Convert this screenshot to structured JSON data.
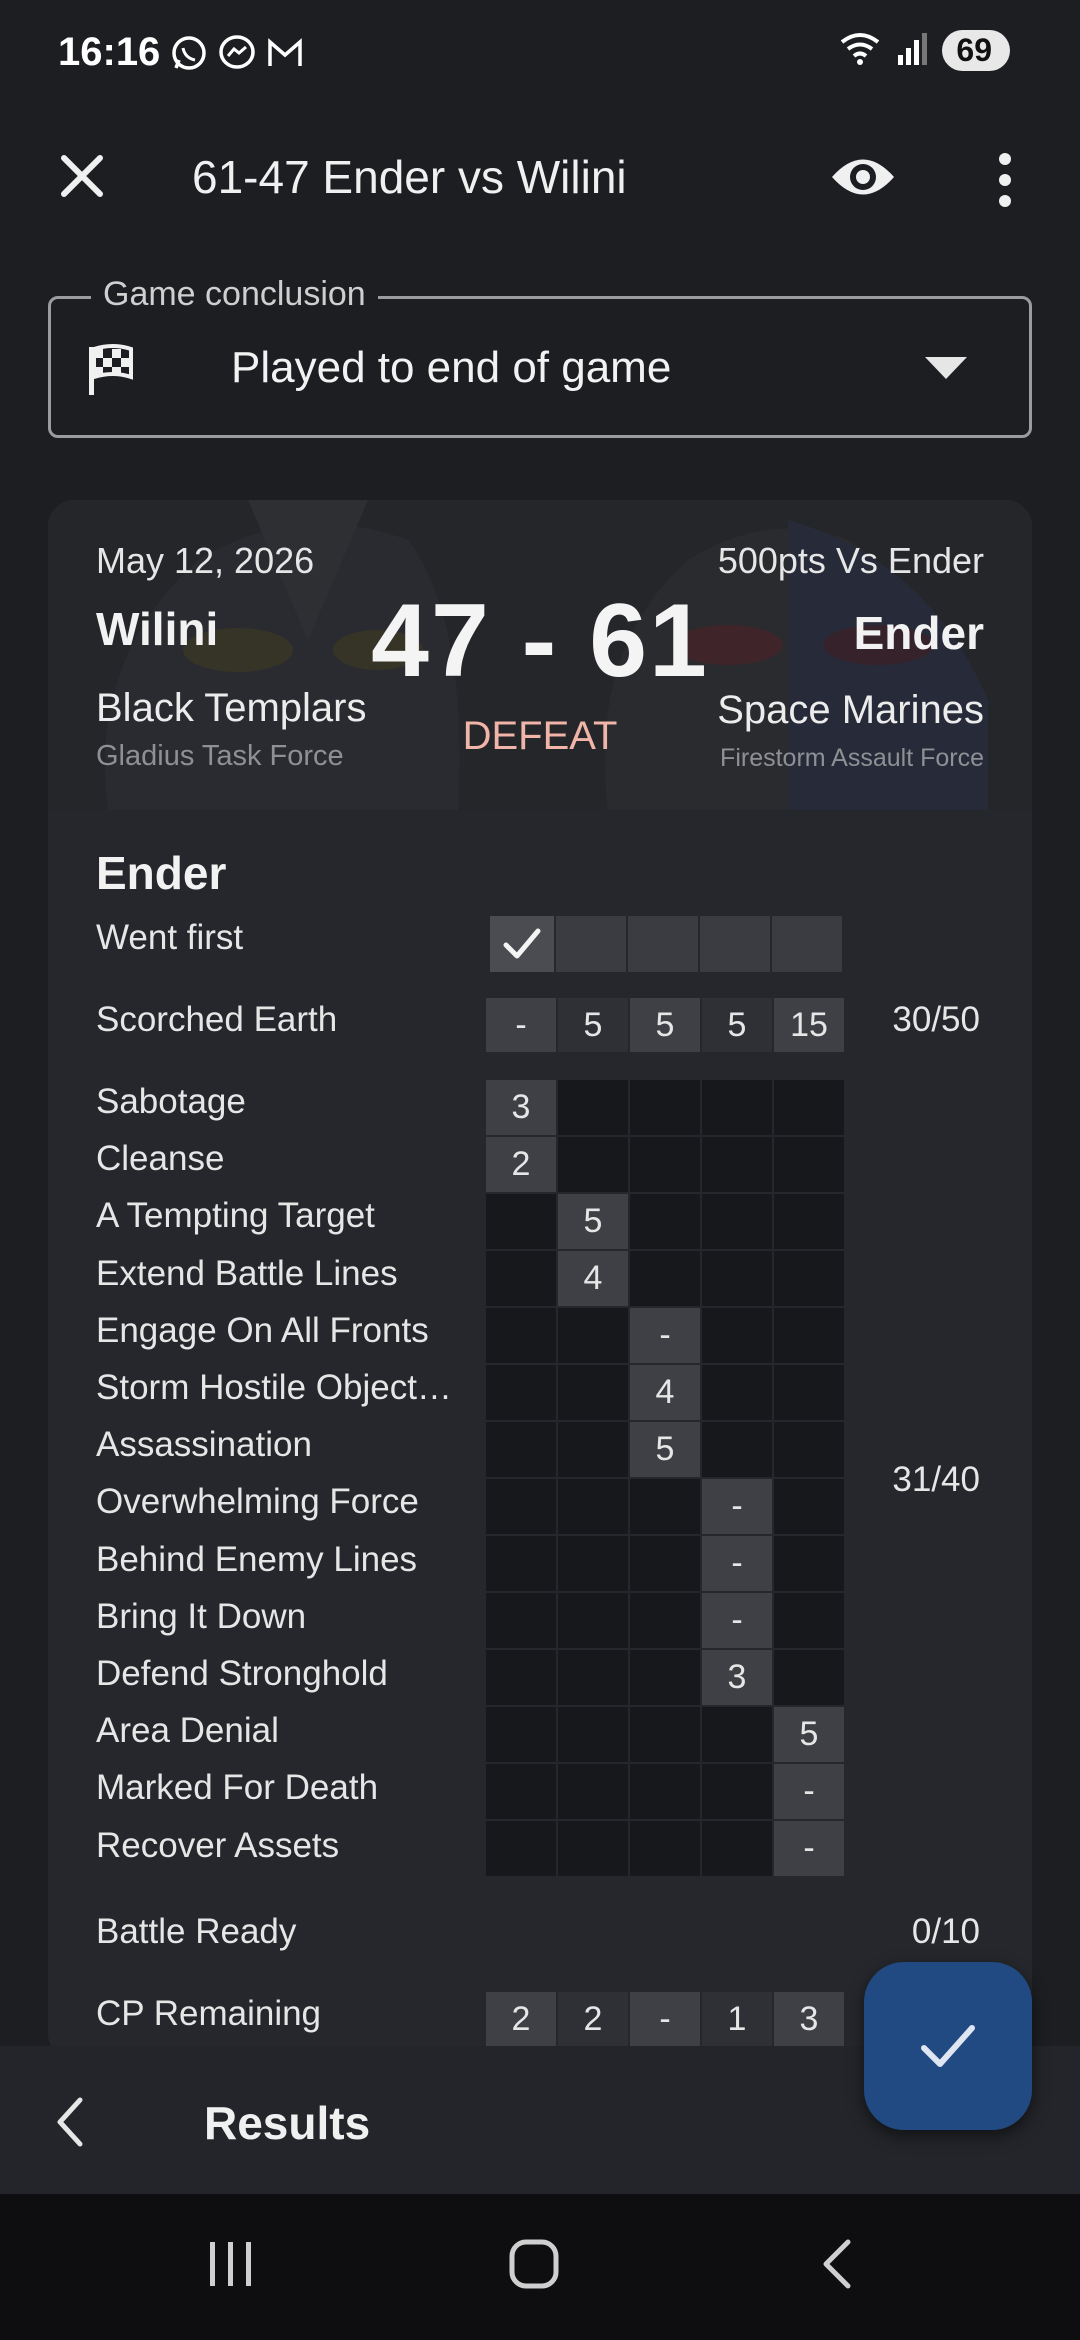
{
  "status": {
    "time": "16:16",
    "battery": "69"
  },
  "app_bar": {
    "title": "61-47 Ender vs Wilini"
  },
  "conclusion": {
    "legend": "Game conclusion",
    "value": "Played to end of game"
  },
  "header": {
    "date": "May 12, 2026",
    "points": "500pts Vs Ender",
    "player1": "Wilini",
    "player2": "Ender",
    "score": "47 - 61",
    "result": "DEFEAT",
    "player1_faction": "Black Templars",
    "player2_faction": "Space Marines",
    "player1_detachment": "Gladius Task Force",
    "player2_detachment": "Firestorm Assault Force"
  },
  "player_section": {
    "title": "Ender",
    "went_first": {
      "label": "Went first",
      "rounds": [
        true,
        false,
        false,
        false,
        false
      ]
    },
    "primary": {
      "label": "Scorched Earth",
      "rounds": [
        "-",
        "5",
        "5",
        "5",
        "15"
      ],
      "total": "30/50"
    },
    "secondaries": [
      {
        "label": "Sabotage",
        "round": 1,
        "value": "3"
      },
      {
        "label": "Cleanse",
        "round": 1,
        "value": "2"
      },
      {
        "label": "A Tempting Target",
        "round": 2,
        "value": "5"
      },
      {
        "label": "Extend Battle Lines",
        "round": 2,
        "value": "4"
      },
      {
        "label": "Engage On All Fronts",
        "round": 3,
        "value": "-"
      },
      {
        "label": "Storm Hostile Object…",
        "round": 3,
        "value": "4"
      },
      {
        "label": "Assassination",
        "round": 3,
        "value": "5"
      },
      {
        "label": "Overwhelming Force",
        "round": 4,
        "value": "-"
      },
      {
        "label": "Behind Enemy Lines",
        "round": 4,
        "value": "-"
      },
      {
        "label": "Bring It Down",
        "round": 4,
        "value": "-"
      },
      {
        "label": "Defend Stronghold",
        "round": 4,
        "value": "3"
      },
      {
        "label": "Area Denial",
        "round": 5,
        "value": "5"
      },
      {
        "label": "Marked For Death",
        "round": 5,
        "value": "-"
      },
      {
        "label": "Recover Assets",
        "round": 5,
        "value": "-"
      }
    ],
    "secondary_total": "31/40",
    "battle_ready": {
      "label": "Battle Ready",
      "total": "0/10"
    },
    "cp_remaining": {
      "label": "CP Remaining",
      "rounds": [
        "2",
        "2",
        "-",
        "1",
        "3"
      ]
    }
  },
  "bottom_bar": {
    "title": "Results"
  },
  "colors": {
    "accent": "#214a82",
    "defeat": "#f0b4a8",
    "background": "#1c1e22",
    "card": "#25272c"
  },
  "icons": [
    "close-icon",
    "eye-icon",
    "more-vert-icon",
    "checkered-flag-icon",
    "dropdown-caret-icon",
    "check-icon",
    "back-chevron-icon"
  ]
}
